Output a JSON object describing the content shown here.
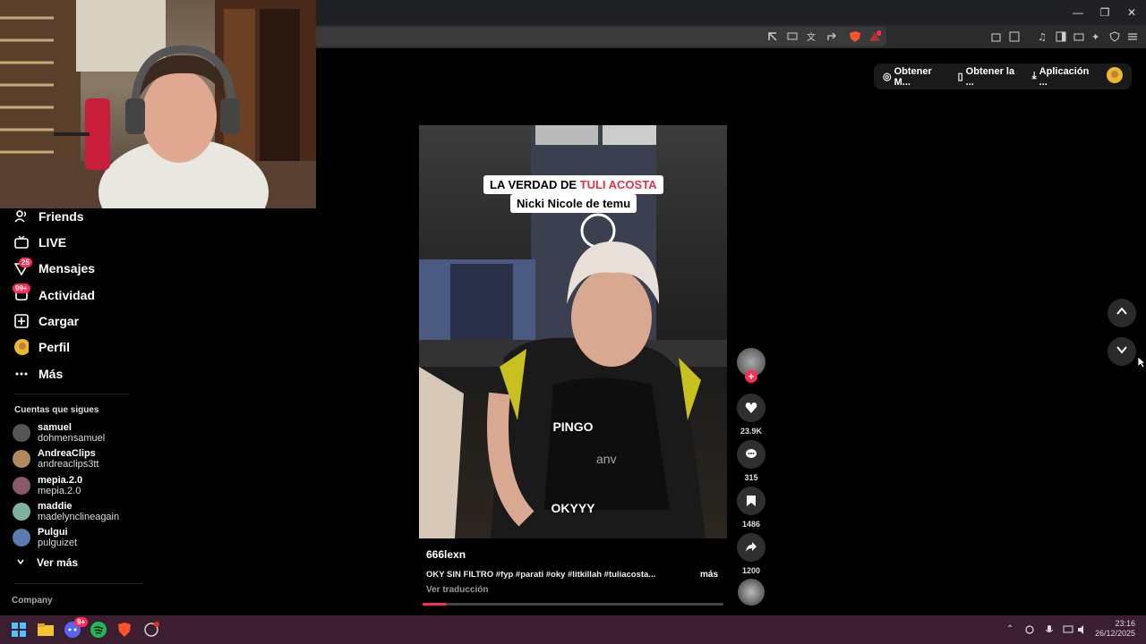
{
  "sidebar": {
    "items": [
      {
        "label": "Friends",
        "icon": "friends-icon"
      },
      {
        "label": "LIVE",
        "icon": "live-icon"
      },
      {
        "label": "Mensajes",
        "icon": "messages-icon",
        "badge": "25"
      },
      {
        "label": "Actividad",
        "icon": "activity-icon",
        "badge": "99+"
      },
      {
        "label": "Cargar",
        "icon": "upload-icon"
      },
      {
        "label": "Perfil",
        "icon": "profile-avatar"
      },
      {
        "label": "Más",
        "icon": "more-icon"
      }
    ],
    "following_title": "Cuentas que sigues",
    "following": [
      {
        "name": "samuel",
        "handle": "dohmensamuel",
        "color": "#555555"
      },
      {
        "name": "AndreaClips",
        "handle": "andreaclips3tt",
        "color": "#b08a5a"
      },
      {
        "name": "mepia.2.0",
        "handle": "mepia.2.0",
        "color": "#8a5a6a"
      },
      {
        "name": "maddie",
        "handle": "madelynclineagain",
        "color": "#7fb0a0"
      },
      {
        "name": "Pulgui",
        "handle": "pulguizet",
        "color": "#5a7ab0"
      }
    ],
    "see_more": "Ver más",
    "company": "Company"
  },
  "top_pills": {
    "get_m": "Obtener M...",
    "get_app": "Obtener la ...",
    "application": "Aplicación ..."
  },
  "video": {
    "caption_line1_prefix": "LA VERDAD DE ",
    "caption_line1_highlight": "TULI ACOSTA",
    "caption_line2": "Nicki Nicole de temu",
    "overlay1": "PINGO",
    "overlay2": "OKYYY",
    "shirt_text": "anv",
    "author": "666lexn",
    "description": "OKY SIN FILTRO #fyp #parati #oky #litkillah #tuliacosta...",
    "more": "más",
    "translate": "Ver traducción",
    "progress": 0.08
  },
  "actions": {
    "likes": "23.9K",
    "comments": "315",
    "saves": "1486",
    "shares": "1200"
  },
  "taskbar": {
    "time": "23:16",
    "date": "26/12/2025",
    "discord_badge": "9+"
  },
  "colors": {
    "accent": "#fe2c55",
    "taskbar": "#3b1e2f"
  }
}
